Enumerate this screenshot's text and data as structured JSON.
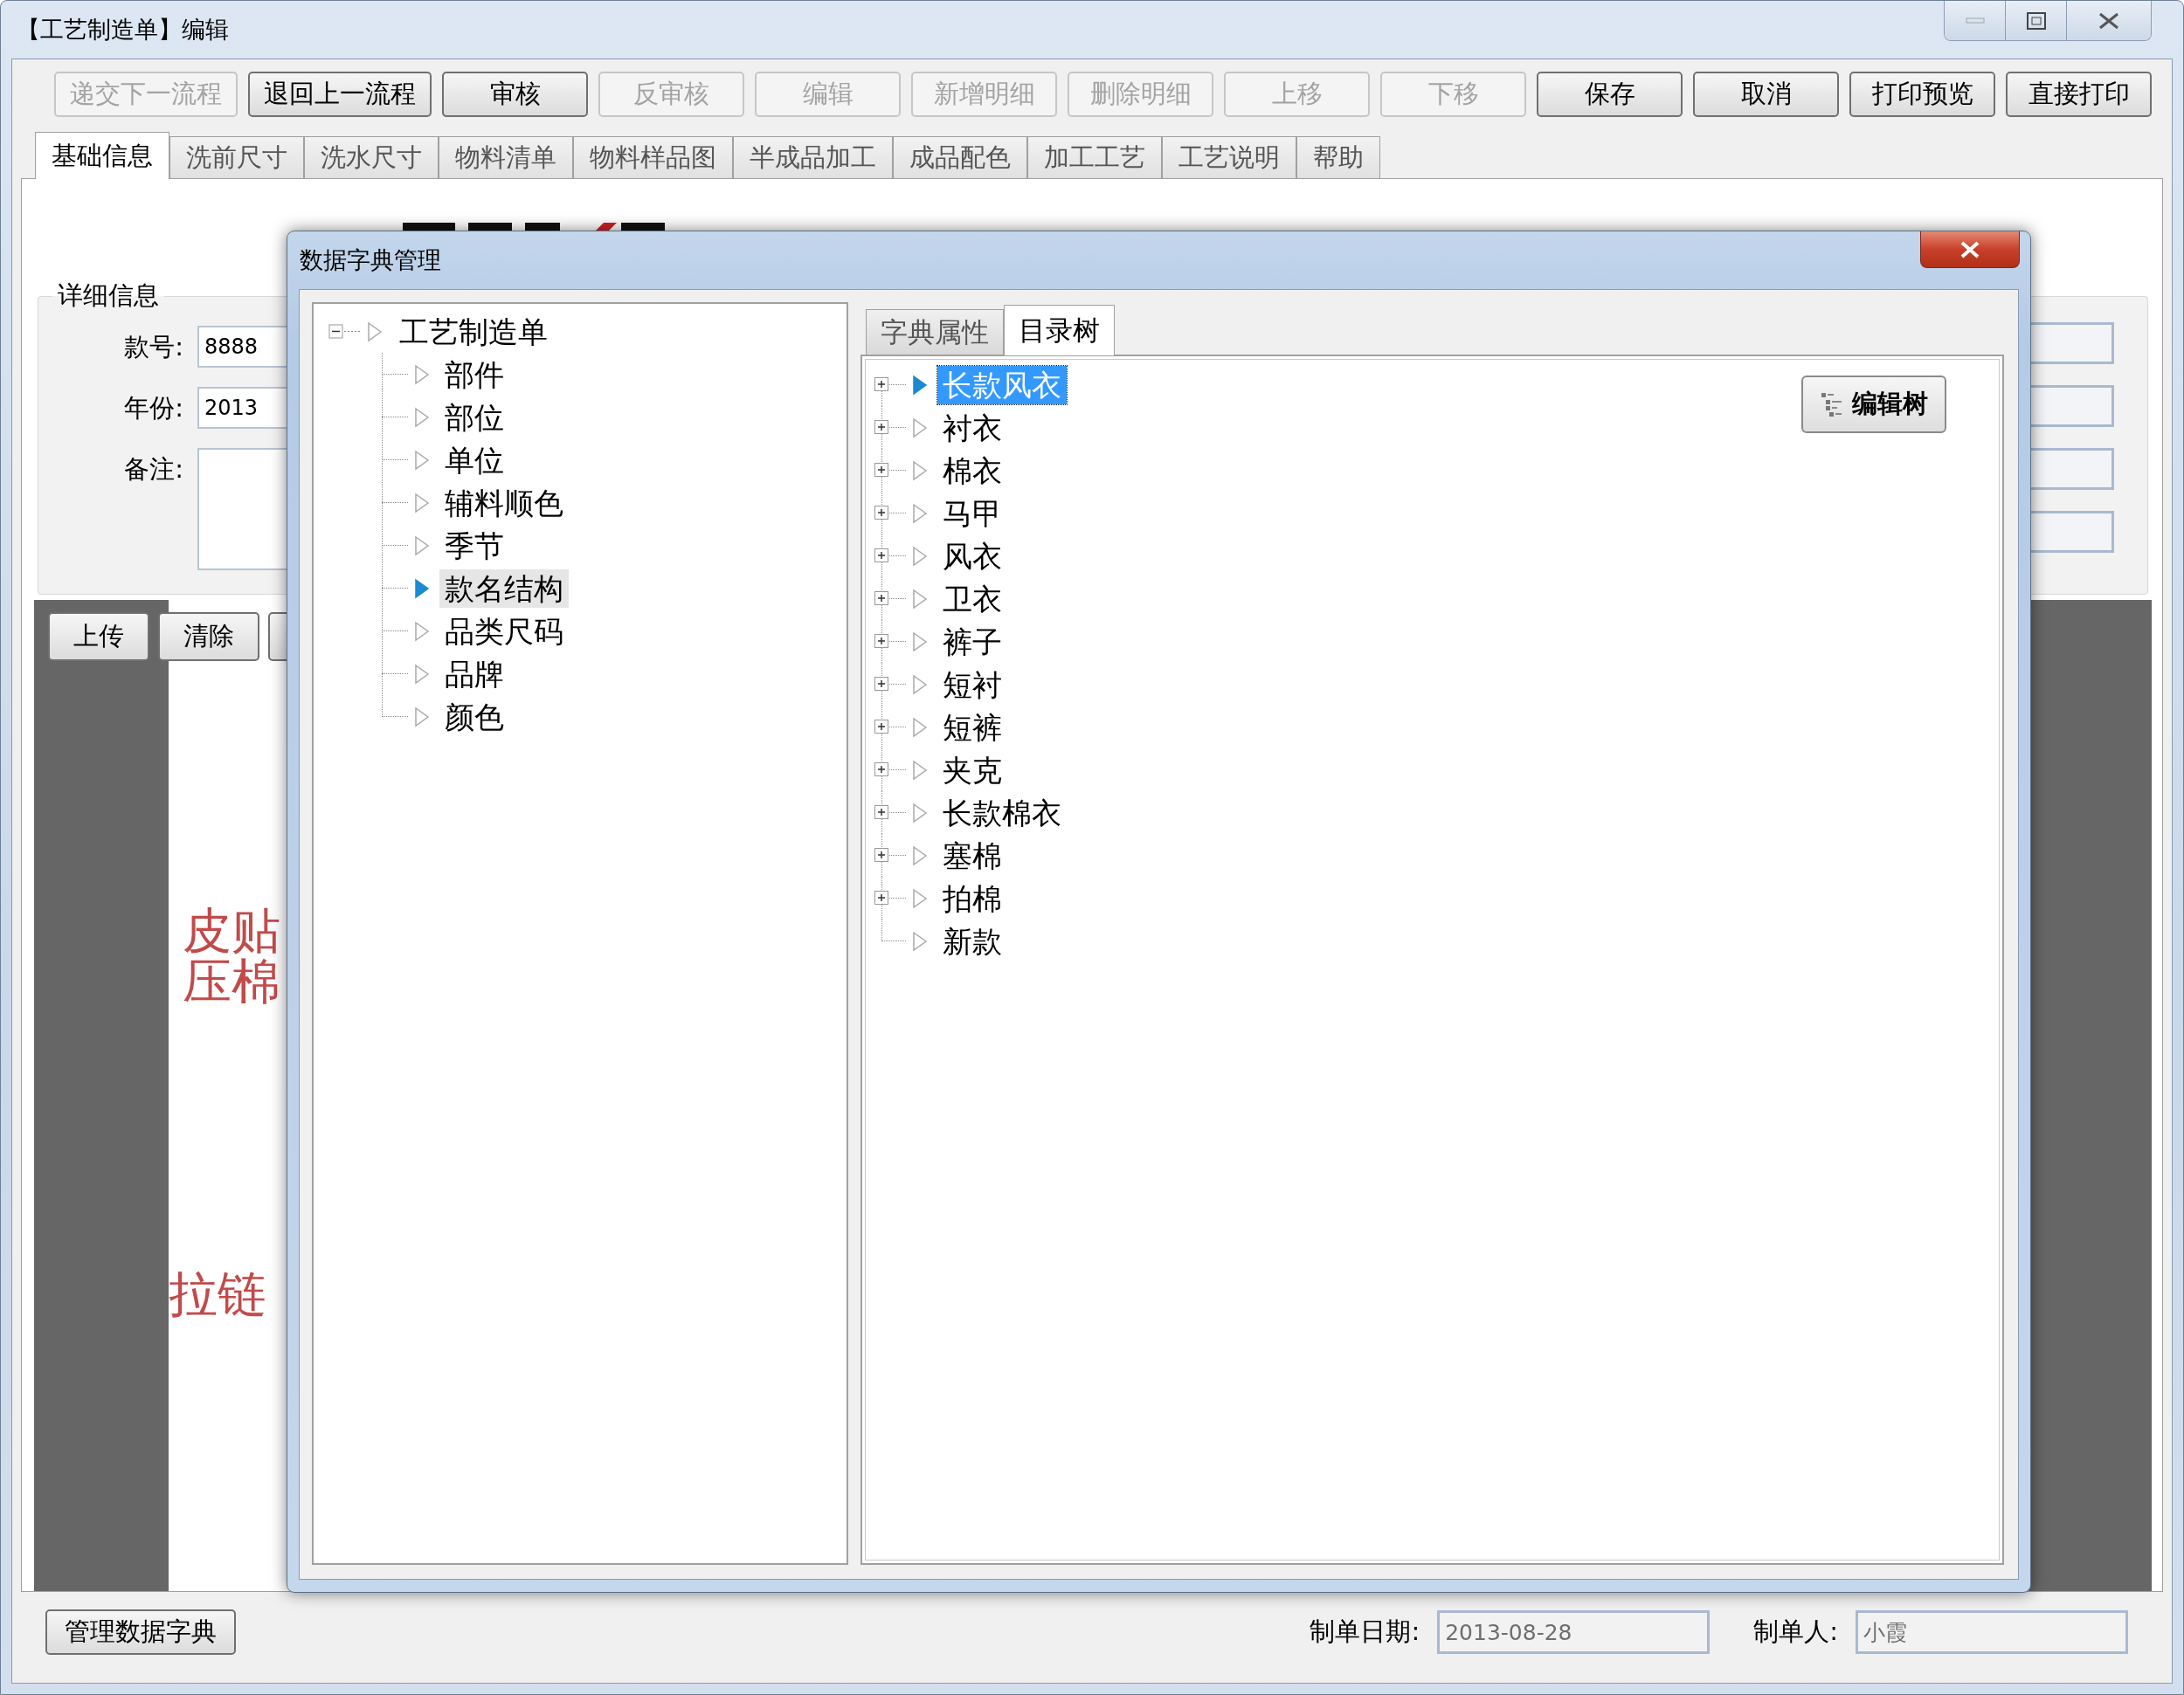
{
  "window": {
    "title": "【工艺制造单】编辑"
  },
  "toolbar": [
    {
      "label": "递交下一流程",
      "disabled": true
    },
    {
      "label": "退回上一流程",
      "disabled": false
    },
    {
      "label": "审核",
      "disabled": false
    },
    {
      "label": "反审核",
      "disabled": true
    },
    {
      "label": "编辑",
      "disabled": true
    },
    {
      "label": "新增明细",
      "disabled": true
    },
    {
      "label": "删除明细",
      "disabled": true
    },
    {
      "label": "上移",
      "disabled": true
    },
    {
      "label": "下移",
      "disabled": true
    },
    {
      "label": "保存",
      "disabled": false
    },
    {
      "label": "取消",
      "disabled": false
    },
    {
      "label": "打印预览",
      "disabled": false
    },
    {
      "label": "直接打印",
      "disabled": false
    }
  ],
  "tabs": [
    {
      "label": "基础信息",
      "selected": true
    },
    {
      "label": "洗前尺寸",
      "selected": false
    },
    {
      "label": "洗水尺寸",
      "selected": false
    },
    {
      "label": "物料清单",
      "selected": false
    },
    {
      "label": "物料样品图",
      "selected": false
    },
    {
      "label": "半成品加工",
      "selected": false
    },
    {
      "label": "成品配色",
      "selected": false
    },
    {
      "label": "加工工艺",
      "selected": false
    },
    {
      "label": "工艺说明",
      "selected": false
    },
    {
      "label": "帮助",
      "selected": false
    }
  ],
  "form": {
    "details": {
      "title": "详细信息",
      "fields": [
        {
          "label": "款号:",
          "kind": "input",
          "value": "8888"
        },
        {
          "label": "年份:",
          "kind": "input",
          "value": "2013"
        },
        {
          "label": "备注:",
          "kind": "textarea"
        }
      ]
    },
    "image_panel": {
      "buttons": [
        "上传",
        "清除"
      ],
      "notes": [
        "皮贴",
        "压棉",
        "拉链"
      ]
    }
  },
  "footer": {
    "button": "管理数据字典",
    "fields": [
      {
        "label": "制单日期:",
        "value": "2013-08-28",
        "disabled": true
      },
      {
        "label": "制单人:",
        "value": "小霞",
        "disabled": true
      }
    ]
  },
  "dialog": {
    "title": "数据字典管理",
    "dictionary_tree": {
      "label": "工艺制造单",
      "expanded": true,
      "selected": false,
      "children": [
        {
          "label": "部件",
          "selected": false
        },
        {
          "label": "部位",
          "selected": false
        },
        {
          "label": "单位",
          "selected": false
        },
        {
          "label": "辅料顺色",
          "selected": false
        },
        {
          "label": "季节",
          "selected": false
        },
        {
          "label": "款名结构",
          "selected": true
        },
        {
          "label": "品类尺码",
          "selected": false
        },
        {
          "label": "品牌",
          "selected": false
        },
        {
          "label": "颜色",
          "selected": false
        }
      ]
    },
    "tabs": [
      {
        "label": "字典属性",
        "selected": false
      },
      {
        "label": "目录树",
        "selected": true
      }
    ],
    "catalog_tree": [
      {
        "label": "长款风衣",
        "expandable": true,
        "selected": true
      },
      {
        "label": "衬衣",
        "expandable": true,
        "selected": false
      },
      {
        "label": "棉衣",
        "expandable": true,
        "selected": false
      },
      {
        "label": "马甲",
        "expandable": true,
        "selected": false
      },
      {
        "label": "风衣",
        "expandable": true,
        "selected": false
      },
      {
        "label": "卫衣",
        "expandable": true,
        "selected": false
      },
      {
        "label": "裤子",
        "expandable": true,
        "selected": false
      },
      {
        "label": "短衬",
        "expandable": true,
        "selected": false
      },
      {
        "label": "短裤",
        "expandable": true,
        "selected": false
      },
      {
        "label": "夹克",
        "expandable": true,
        "selected": false
      },
      {
        "label": "长款棉衣",
        "expandable": true,
        "selected": false
      },
      {
        "label": "塞棉",
        "expandable": true,
        "selected": false
      },
      {
        "label": "拍棉",
        "expandable": true,
        "selected": false
      },
      {
        "label": "新款",
        "expandable": false,
        "selected": false
      }
    ],
    "edit_button": "编辑树"
  }
}
